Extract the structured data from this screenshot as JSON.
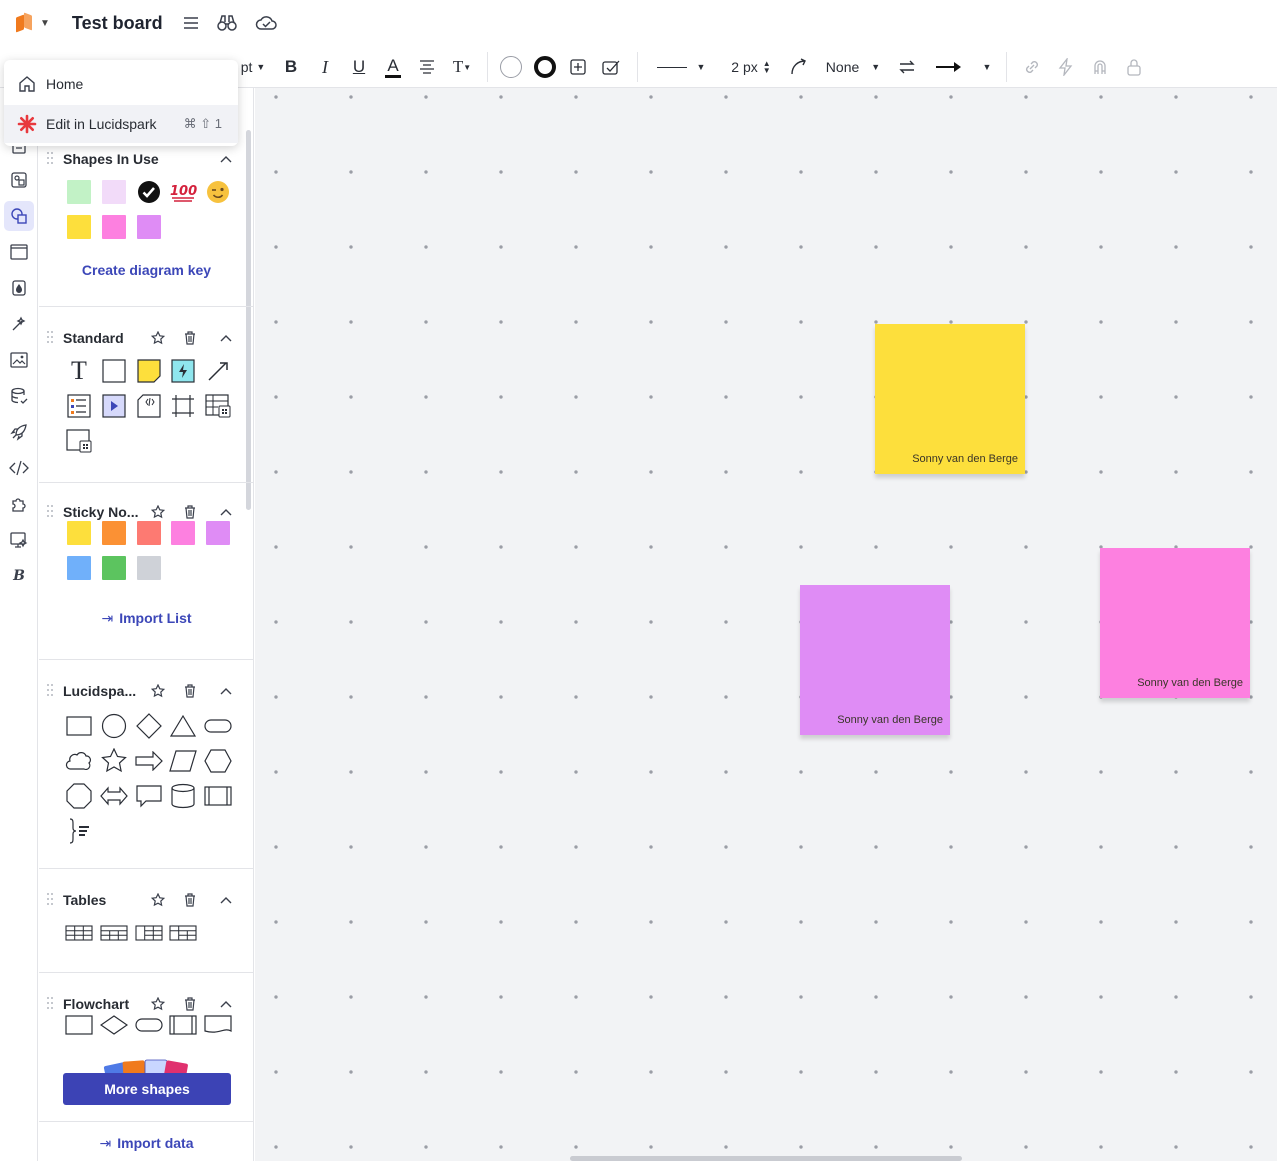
{
  "header": {
    "title": "Test board",
    "icons": [
      "lucid-logo",
      "menu-icon",
      "binoculars-icon",
      "cloud-icon"
    ]
  },
  "toolbar": {
    "font_size_unit": "pt",
    "line_width": "2 px",
    "line_end": "None"
  },
  "dropdown": {
    "items": [
      {
        "label": "Home",
        "shortcut": "",
        "icon": "home-icon"
      },
      {
        "label": "Edit in Lucidspark",
        "shortcut": "⌘ ⇧ 1",
        "icon": "lucidspark-icon"
      }
    ]
  },
  "panel": {
    "sections": [
      {
        "title": "Shapes In Use",
        "action": "Create diagram key"
      },
      {
        "title": "Standard"
      },
      {
        "title": "Sticky No...",
        "action": "Import List"
      },
      {
        "title": "Lucidspa..."
      },
      {
        "title": "Tables"
      },
      {
        "title": "Flowchart"
      }
    ],
    "more_shapes": "More shapes",
    "import_data": "Import data"
  },
  "colors": {
    "accent": "#3c43b5",
    "sticky_yellow": "#fddf3c",
    "sticky_purple": "#df8cf5",
    "sticky_pink": "#fd80e0",
    "sticky_orange": "#fb9134",
    "sticky_red": "#fd7a72",
    "sticky_blue": "#70b0fa",
    "sticky_green": "#5cc45f",
    "sticky_gray": "#cfd2d8",
    "light_green": "#c2f2c6",
    "light_purple": "#f2dbf9"
  },
  "canvas": {
    "stickies": [
      {
        "author": "Sonny van den Berge",
        "color": "yellow"
      },
      {
        "author": "Sonny van den Berge",
        "color": "purple"
      },
      {
        "author": "Sonny van den Berge",
        "color": "pink"
      }
    ]
  }
}
